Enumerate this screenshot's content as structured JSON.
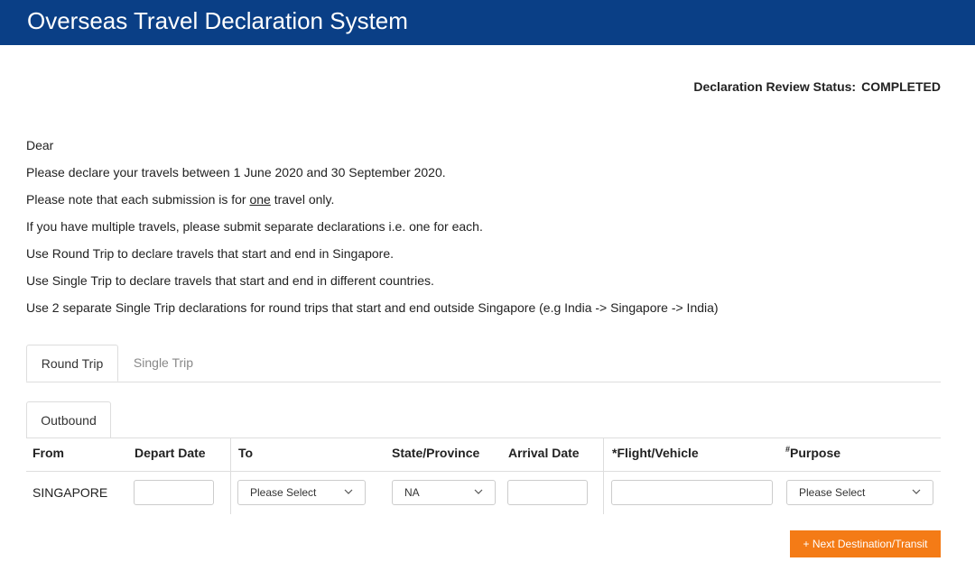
{
  "header": {
    "title": "Overseas Travel Declaration System"
  },
  "status": {
    "label": "Declaration Review Status:",
    "value": "COMPLETED"
  },
  "intro": {
    "greeting": "Dear",
    "line1": "Please declare your travels between 1 June 2020 and 30 September 2020.",
    "line2_pre": "Please note that each submission is for ",
    "line2_underlined": "one",
    "line2_post": " travel only.",
    "line3": "If you have multiple travels, please submit separate declarations i.e. one for each.",
    "line4": "Use Round Trip to declare travels that start and end in Singapore.",
    "line5": "Use Single Trip to declare travels that start and end in different countries.",
    "line6": "Use 2 separate Single Trip declarations for round trips that start and end outside Singapore (e.g India -> Singapore -> India)"
  },
  "tabs": {
    "round_trip": "Round Trip",
    "single_trip": "Single Trip"
  },
  "subtab": {
    "outbound": "Outbound"
  },
  "table": {
    "headers": {
      "from": "From",
      "depart_date": "Depart Date",
      "to": "To",
      "state_province": "State/Province",
      "arrival_date": "Arrival Date",
      "flight_vehicle": "*Flight/Vehicle",
      "purpose_mark": "#",
      "purpose": "Purpose"
    },
    "row": {
      "from": "SINGAPORE",
      "depart_date": "",
      "to": "Please Select",
      "state_province": "NA",
      "arrival_date": "",
      "flight_vehicle": "",
      "purpose": "Please Select"
    }
  },
  "actions": {
    "next_destination": "+ Next Destination/Transit"
  },
  "colors": {
    "header_bg": "#0a3f86",
    "button_bg": "#f47b16",
    "border": "#dddddd"
  },
  "icons": {
    "dropdown": "chevron-down-icon"
  }
}
